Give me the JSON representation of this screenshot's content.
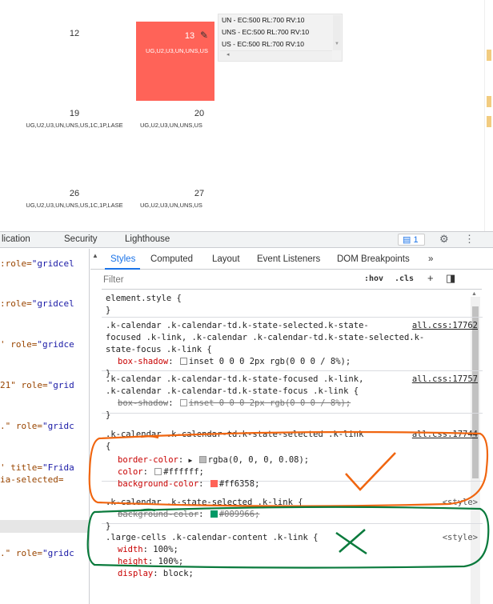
{
  "calendar": {
    "cells": [
      {
        "day": "12",
        "tags": ""
      },
      {
        "day": "13",
        "tags": "UG,U2,U3,UN,UNS,US"
      },
      {
        "day": "19",
        "tags": "UG,U2,U3,UN,UNS,US,1C,1P,LASE"
      },
      {
        "day": "20",
        "tags": "UG,U2,U3,UN,UNS,US"
      },
      {
        "day": "26",
        "tags": "UG,U2,U3,UN,UNS,US,1C,1P,LASE"
      },
      {
        "day": "27",
        "tags": "UG,U2,U3,UN,UNS,US"
      }
    ],
    "selected_color": "#ff6358",
    "popup_lines": [
      "UN - EC:500 RL:700 RV:10",
      "UNS - EC:500 RL:700 RV:10",
      "US - EC:500 RL:700 RV:10"
    ]
  },
  "devtools": {
    "top_tabs": [
      "lication",
      "Security",
      "Lighthouse"
    ],
    "issues_badge": "1",
    "dom_rows": [
      {
        "attr": "role",
        "val": "\"gridcel",
        "prefix": ":"
      },
      {
        "attr": "role",
        "val": "\"gridcel",
        "prefix": ":"
      },
      {
        "attr": "role",
        "val": "\"gridce",
        "prefix": "' "
      },
      {
        "attr": "role",
        "val": "\"grid",
        "prefix": "21\" "
      },
      {
        "attr": "role",
        "val": "\"gridc",
        "prefix": ".\" "
      },
      {
        "attr": "title",
        "val": "\"Frida",
        "prefix": "' "
      },
      {
        "attr": "ia-selected",
        "val": "",
        "prefix": ""
      },
      {
        "attr": "role",
        "val": "\"gridc",
        "prefix": ".\" "
      }
    ],
    "styles_tabs": [
      "Styles",
      "Computed",
      "Layout",
      "Event Listeners",
      "DOM Breakpoints",
      "»"
    ],
    "filter_placeholder": "Filter",
    "hov_label": ":hov",
    "cls_label": ".cls",
    "rules": {
      "r0_selector": "element.style {",
      "r1_selector": ".k-calendar .k-calendar-td.k-state-selected.k-state-\nfocused .k-link, .k-calendar .k-calendar-td.k-state-selected.k-\nstate-focus .k-link {",
      "r1_source": "all.css:17762",
      "r1_prop": "box-shadow",
      "r1_val": "inset 0 0 0 2px rgb(0 0 0 / 8%);",
      "r2_selector": ".k-calendar .k-calendar-td.k-state-focused .k-link,\n.k-calendar .k-calendar-td.k-state-focus .k-link {",
      "r2_source": "all.css:17757",
      "r2_prop": "box-shadow",
      "r2_val": "inset 0 0 0 2px rgb(0 0 0 / 8%);",
      "r3_selector": ".k-calendar .k-calendar-td.k-state-selected .k-link",
      "r3_source": "all.css:17744",
      "r3_p1": "border-color",
      "r3_v1": "rgba(0, 0, 0, 0.08);",
      "r3_p2": "color",
      "r3_v2": "#ffffff;",
      "r3_p3": "background-color",
      "r3_v3": "#ff6358;",
      "r4_selector": ".k-calendar .k-state-selected .k-link {",
      "r4_source": "<style>",
      "r4_prop": "background-color",
      "r4_val": "#009966;",
      "r5_selector": ".large-cells .k-calendar-content .k-link {",
      "r5_source": "<style>",
      "r5_p1": "width",
      "r5_v1": "100%;",
      "r5_p2": "height",
      "r5_v2": "100%;",
      "r5_p3": "display",
      "r5_v3": "block;"
    },
    "close_brace": "}",
    "open_brace": "{",
    "swatch_red": "#ff6358",
    "swatch_green": "#009966",
    "annotation_orange": "#f0650f",
    "annotation_green": "#0a7a3c"
  }
}
